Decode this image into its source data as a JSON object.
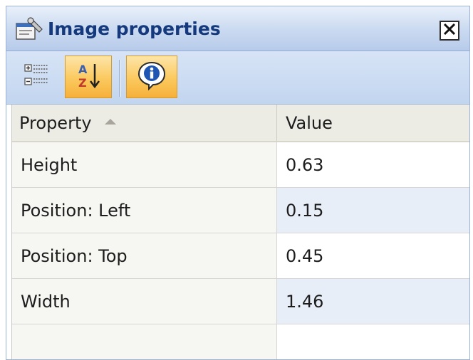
{
  "window": {
    "title": "Image properties",
    "close_label": "X"
  },
  "toolbar": {
    "buttons": [
      {
        "icon": "categorized-icon",
        "active": false
      },
      {
        "icon": "sort-alphabetical-icon",
        "active": true
      },
      {
        "icon": "info-icon",
        "active": true
      }
    ],
    "sort_glyph": "A Z",
    "info_glyph": "i"
  },
  "grid": {
    "columns": [
      "Property",
      "Value"
    ],
    "sorted_column": "Property",
    "sort_direction": "ascending",
    "rows": [
      {
        "property": "Height",
        "value": "0.63"
      },
      {
        "property": "Position: Left",
        "value": "0.15"
      },
      {
        "property": "Position: Top",
        "value": "0.45"
      },
      {
        "property": "Width",
        "value": "1.46"
      }
    ]
  },
  "colors": {
    "title_text": "#143a7d",
    "titlebar_bg": "#c9d9f0",
    "toolbar_active": "#fbc95e",
    "value_alt_row": "#e8eef8"
  }
}
